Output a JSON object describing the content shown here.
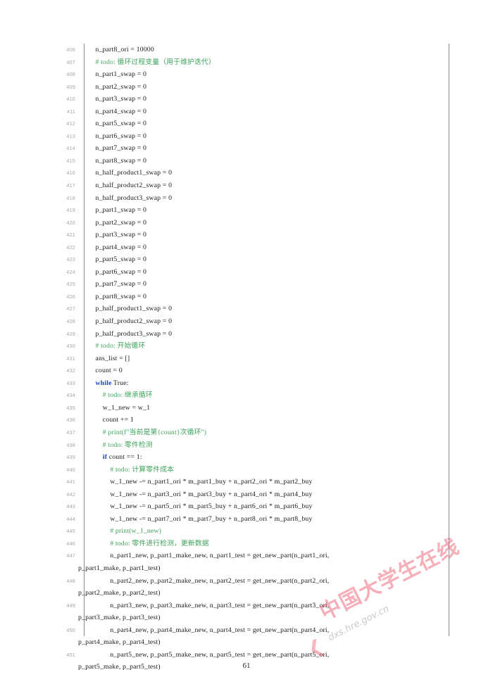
{
  "document": {
    "page_number": "61",
    "language": "python"
  },
  "watermark": {
    "text_cn": "中国大学生在线",
    "url": "dxs.hre.gov.cn",
    "mark": "❮",
    "color_cn": "#e8546b",
    "color_url": "#b9b9bd"
  },
  "colors": {
    "comment": "#3fa45c",
    "keyword": "#1a3fd1",
    "code": "#1a1a1a",
    "lineno": "#a6a6a6",
    "rule": "#8c8c8c"
  },
  "code": {
    "lines": [
      {
        "no": "406",
        "type": "code",
        "text": "    n_part8_ori = 10000"
      },
      {
        "no": "407",
        "type": "comment",
        "text": "    # todo: 循环过程变量（用于维护迭代）"
      },
      {
        "no": "408",
        "type": "code",
        "text": "    n_part1_swap = 0"
      },
      {
        "no": "409",
        "type": "code",
        "text": "    n_part2_swap = 0"
      },
      {
        "no": "410",
        "type": "code",
        "text": "    n_part3_swap = 0"
      },
      {
        "no": "411",
        "type": "code",
        "text": "    n_part4_swap = 0"
      },
      {
        "no": "412",
        "type": "code",
        "text": "    n_part5_swap = 0"
      },
      {
        "no": "413",
        "type": "code",
        "text": "    n_part6_swap = 0"
      },
      {
        "no": "414",
        "type": "code",
        "text": "    n_part7_swap = 0"
      },
      {
        "no": "415",
        "type": "code",
        "text": "    n_part8_swap = 0"
      },
      {
        "no": "416",
        "type": "code",
        "text": "    n_half_product1_swap = 0"
      },
      {
        "no": "417",
        "type": "code",
        "text": "    n_half_product2_swap = 0"
      },
      {
        "no": "418",
        "type": "code",
        "text": "    n_half_product3_swap = 0"
      },
      {
        "no": "419",
        "type": "code",
        "text": "    p_part1_swap = 0"
      },
      {
        "no": "420",
        "type": "code",
        "text": "    p_part2_swap = 0"
      },
      {
        "no": "421",
        "type": "code",
        "text": "    p_part3_swap = 0"
      },
      {
        "no": "422",
        "type": "code",
        "text": "    p_part4_swap = 0"
      },
      {
        "no": "423",
        "type": "code",
        "text": "    p_part5_swap = 0"
      },
      {
        "no": "424",
        "type": "code",
        "text": "    p_part6_swap = 0"
      },
      {
        "no": "425",
        "type": "code",
        "text": "    p_part7_swap = 0"
      },
      {
        "no": "426",
        "type": "code",
        "text": "    p_part8_swap = 0"
      },
      {
        "no": "427",
        "type": "code",
        "text": "    p_half_product1_swap = 0"
      },
      {
        "no": "428",
        "type": "code",
        "text": "    p_half_product2_swap = 0"
      },
      {
        "no": "429",
        "type": "code",
        "text": "    p_half_product3_swap = 0"
      },
      {
        "no": "430",
        "type": "comment",
        "text": "    # todo: 开始循环"
      },
      {
        "no": "431",
        "type": "code",
        "text": "    ans_list = []"
      },
      {
        "no": "432",
        "type": "code",
        "text": "    count = 0"
      },
      {
        "no": "433",
        "type": "keyword",
        "keyword": "while",
        "rest": " True:",
        "indent": "    ",
        "text": "    while True:"
      },
      {
        "no": "434",
        "type": "comment",
        "text": "        # todo: 继承循环"
      },
      {
        "no": "435",
        "type": "code",
        "text": "        w_1_new = w_1"
      },
      {
        "no": "436",
        "type": "code",
        "text": "        count += 1"
      },
      {
        "no": "437",
        "type": "comment",
        "text": "        # print(f\"当前是第{count}次循环\")"
      },
      {
        "no": "438",
        "type": "comment",
        "text": "        # todo: 零件检测"
      },
      {
        "no": "439",
        "type": "keyword",
        "keyword": "if",
        "rest": " count == 1:",
        "indent": "        ",
        "text": "        if count == 1:"
      },
      {
        "no": "440",
        "type": "comment",
        "text": "            # todo: 计算零件成本"
      },
      {
        "no": "441",
        "type": "code",
        "text": "            w_1_new -= n_part1_ori * m_part1_buy + n_part2_ori * m_part2_buy"
      },
      {
        "no": "442",
        "type": "code",
        "text": "            w_1_new -= n_part3_ori * m_part3_buy + n_part4_ori * m_part4_buy"
      },
      {
        "no": "443",
        "type": "code",
        "text": "            w_1_new -= n_part5_ori * m_part5_buy + n_part6_ori * m_part6_buy"
      },
      {
        "no": "444",
        "type": "code",
        "text": "            w_1_new -= n_part7_ori * m_part7_buy + n_part8_ori * m_part8_buy"
      },
      {
        "no": "445",
        "type": "comment",
        "text": "            # print(w_1_new)"
      },
      {
        "no": "446",
        "type": "comment",
        "text": "            # todo: 零件进行检测，更新数据"
      },
      {
        "no": "447",
        "type": "code",
        "text": "            n_part1_new, p_part1_make_new, n_part1_test = get_new_part(n_part1_ori,"
      },
      {
        "no": "",
        "type": "cont",
        "text": "p_part1_make, p_part1_test)"
      },
      {
        "no": "448",
        "type": "code",
        "text": "            n_part2_new, p_part2_make_new, n_part2_test = get_new_part(n_part2_ori,"
      },
      {
        "no": "",
        "type": "cont",
        "text": "p_part2_make, p_part2_test)"
      },
      {
        "no": "449",
        "type": "code",
        "text": "            n_part3_new, p_part3_make_new, n_part3_test = get_new_part(n_part3_ori,"
      },
      {
        "no": "",
        "type": "cont",
        "text": "p_part3_make, p_part3_test)"
      },
      {
        "no": "450",
        "type": "code",
        "text": "            n_part4_new, p_part4_make_new, n_part4_test = get_new_part(n_part4_ori,"
      },
      {
        "no": "",
        "type": "cont",
        "text": "p_part4_make, p_part4_test)"
      },
      {
        "no": "451",
        "type": "code",
        "text": "            n_part5_new, p_part5_make_new, n_part5_test = get_new_part(n_part5_ori,"
      },
      {
        "no": "",
        "type": "cont",
        "text": "p_part5_make, p_part5_test)"
      }
    ]
  }
}
